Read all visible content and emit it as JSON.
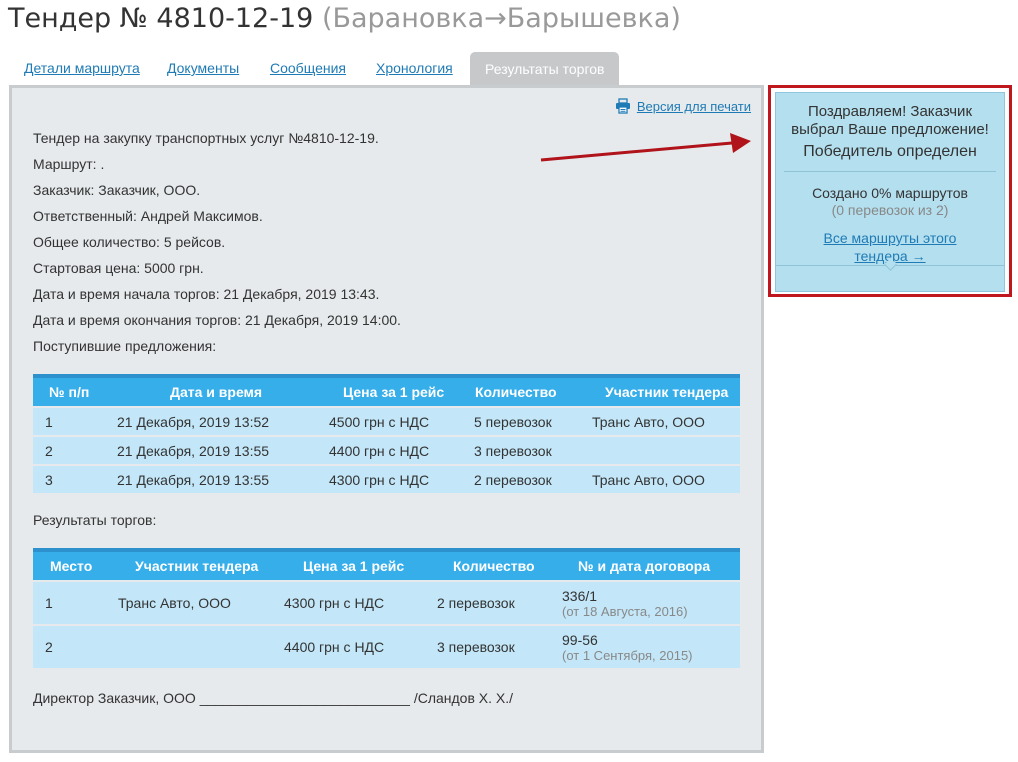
{
  "header": {
    "title": "Тендер № 4810-12-19",
    "route": "(Барановка→Барышевка)"
  },
  "tabs": [
    {
      "label": "Детали маршрута"
    },
    {
      "label": "Документы"
    },
    {
      "label": "Сообщения"
    },
    {
      "label": "Хронология"
    },
    {
      "label": "Результаты торгов",
      "active": true
    }
  ],
  "print": {
    "label": "Версия для печати",
    "icon": "printer-icon"
  },
  "info_lines": [
    "Тендер на закупку транспортных услуг №4810-12-19.",
    "Маршрут: .",
    "Заказчик: Заказчик, ООО.",
    "Ответственный: Андрей Максимов.",
    "Общее количество: 5 рейсов.",
    "Стартовая цена: 5000 грн.",
    "Дата и время начала торгов: 21 Декабря, 2019 13:43.",
    "Дата и время окончания торгов: 21 Декабря, 2019 14:00.",
    "Поступившие предложения:"
  ],
  "offers_table": {
    "headers": [
      "№ п/п",
      "Дата и время",
      "Цена за 1 рейс",
      "Количество",
      "Участник тендера"
    ],
    "rows": [
      [
        "1",
        "21 Декабря, 2019 13:52",
        "4500 грн с НДС",
        "5 перевозок",
        "Транс Авто, ООО"
      ],
      [
        "2",
        "21 Декабря, 2019 13:55",
        "4400 грн с НДС",
        "3 перевозок",
        ""
      ],
      [
        "3",
        "21 Декабря, 2019 13:55",
        "4300 грн с НДС",
        "2 перевозок",
        "Транс Авто, ООО"
      ]
    ]
  },
  "results_label": "Результаты торгов:",
  "results_table": {
    "headers": [
      "Место",
      "Участник тендера",
      "Цена за 1 рейс",
      "Количество",
      "№ и дата договора"
    ],
    "rows": [
      [
        "1",
        "Транс Авто, ООО",
        "4300 грн с НДС",
        "2 перевозок",
        "336/1",
        "(от 18 Августа, 2016)"
      ],
      [
        "2",
        "",
        "4400 грн с НДС",
        "3 перевозок",
        "99-56",
        "(от 1 Сентября, 2015)"
      ]
    ]
  },
  "signature": "Директор Заказчик, ООО ___________________________ /Сландов Х. Х./",
  "winner_box": {
    "congrats_line1": "Поздравляем! Заказчик",
    "congrats_line2": "выбрал Ваше предложение!",
    "winner": "Победитель определен",
    "created": "Создано 0% маршрутов",
    "created_sub": "(0 перевозок из 2)",
    "all_routes_line1": "Все маршруты этого",
    "all_routes_line2": "тендера →"
  },
  "colors": {
    "link": "#1f7bb5",
    "table_header": "#36aeea",
    "table_row": "#c3e7f8",
    "panel_bg": "#e6eaec",
    "highlight_border": "#c0171e",
    "winner_bg": "#b4dfee"
  }
}
